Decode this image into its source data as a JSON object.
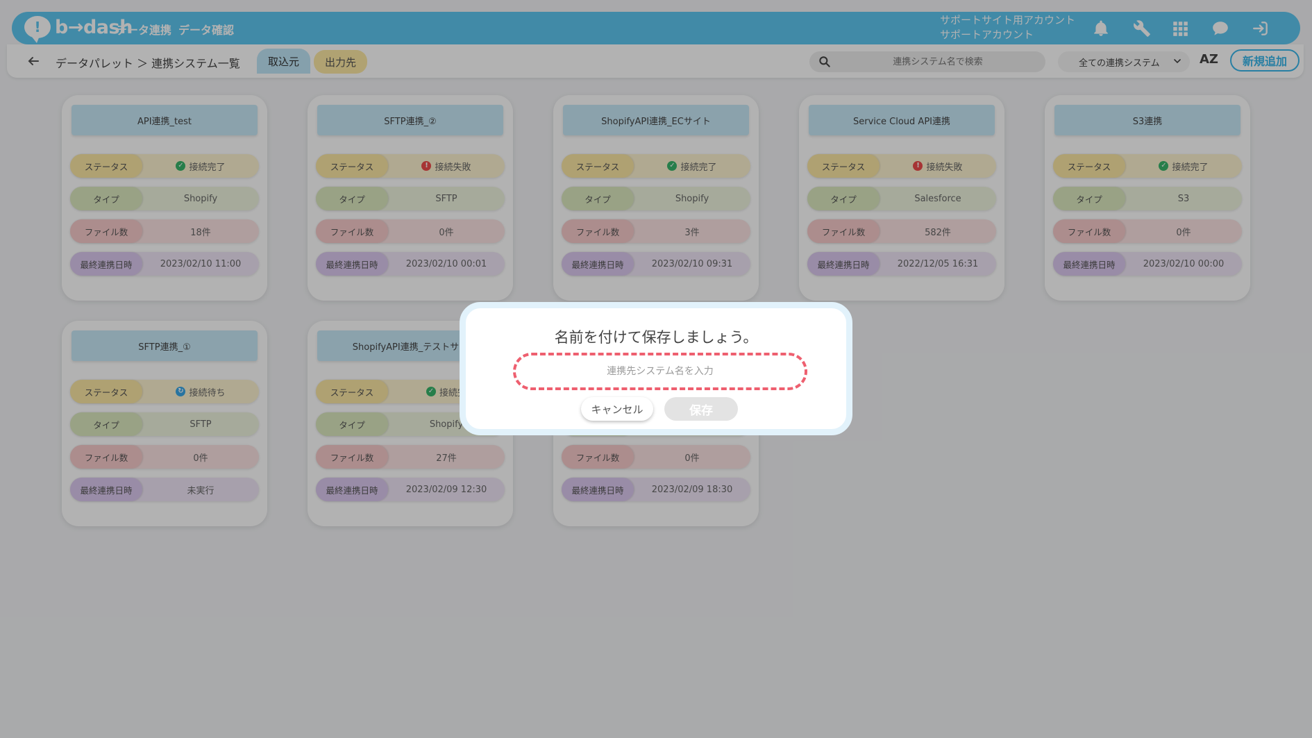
{
  "header": {
    "logo_text": "b→dash",
    "nav": [
      "データ連携",
      "データ確認"
    ],
    "account_line1": "サポートサイト用アカウント",
    "account_line2": "サポートアカウント",
    "icons": [
      "bell-icon",
      "wrench-icon",
      "apps-grid-icon",
      "chat-help-icon",
      "logout-icon"
    ],
    "brand_color": "#5dc6f0"
  },
  "subbar": {
    "breadcrumb": "データパレット ＞ 連携システム一覧",
    "tabs": [
      "取込元",
      "出力先"
    ],
    "search_placeholder": "連携システム名で検索",
    "filter_value": "全ての連携システム",
    "sort_label": "AZ",
    "new_button": "新規追加"
  },
  "labels": {
    "status": "ステータス",
    "type": "タイプ",
    "files": "ファイル数",
    "last_date": "最終連携日時"
  },
  "cards": [
    {
      "title": "API連携_test",
      "status": "接続完了",
      "status_kind": "ok",
      "type": "Shopify",
      "files": "18件",
      "date": "2023/02/10 11:00"
    },
    {
      "title": "SFTP連携_②",
      "status": "接続失敗",
      "status_kind": "err",
      "type": "SFTP",
      "files": "0件",
      "date": "2023/02/10 00:01"
    },
    {
      "title": "ShopifyAPI連携_ECサイト",
      "status": "接続完了",
      "status_kind": "ok",
      "type": "Shopify",
      "files": "3件",
      "date": "2023/02/10 09:31"
    },
    {
      "title": "Service Cloud API連携",
      "status": "接続失敗",
      "status_kind": "err",
      "type": "Salesforce",
      "files": "582件",
      "date": "2022/12/05 16:31"
    },
    {
      "title": "S3連携",
      "status": "接続完了",
      "status_kind": "ok",
      "type": "S3",
      "files": "0件",
      "date": "2023/02/10 00:00"
    },
    {
      "title": "SFTP連携_①",
      "status": "接続待ち",
      "status_kind": "wait",
      "type": "SFTP",
      "files": "0件",
      "date": "未実行"
    },
    {
      "title": "ShopifyAPI連携_テストサイ",
      "status": "接続完",
      "status_kind": "ok",
      "type": "Shopify",
      "files": "27件",
      "date": "2023/02/09 12:30"
    },
    {
      "title": "",
      "status": "",
      "status_kind": "",
      "type": "",
      "files": "0件",
      "date": "2023/02/09 18:30"
    }
  ],
  "modal": {
    "title": "名前を付けて保存しましょう。",
    "input_placeholder": "連携先システム名を入力",
    "input_value": "",
    "cancel": "キャンセル",
    "save": "保存"
  }
}
